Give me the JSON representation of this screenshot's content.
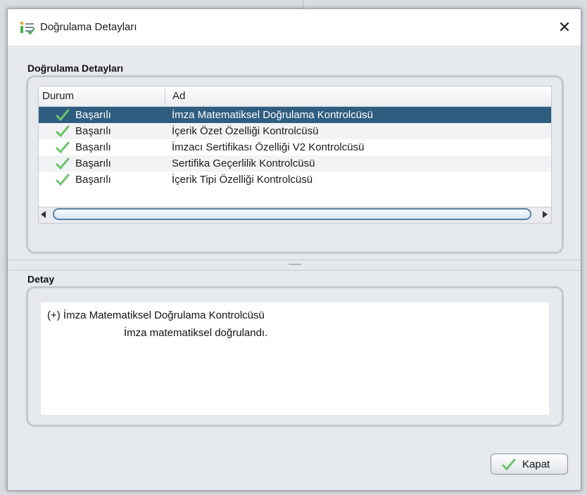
{
  "window": {
    "title": "Doğrulama Detayları",
    "icon": "app-verify-icon",
    "close_glyph": "✕"
  },
  "results_section": {
    "title": "Doğrulama Detayları",
    "columns": [
      "Durum",
      "Ad"
    ],
    "rows": [
      {
        "status": "Başarılı",
        "name": "İmza Matematiksel Doğrulama Kontrolcüsü",
        "selected": true
      },
      {
        "status": "Başarılı",
        "name": "İçerik Özet Özelliği Kontrolcüsü",
        "selected": false
      },
      {
        "status": "Başarılı",
        "name": "İmzacı Sertifikası Özelliği V2 Kontrolcüsü",
        "selected": false
      },
      {
        "status": "Başarılı",
        "name": "Sertifika Geçerlilik Kontrolcüsü",
        "selected": false
      },
      {
        "status": "Başarılı",
        "name": "İçerik Tipi Özelliği Kontrolcüsü",
        "selected": false
      }
    ]
  },
  "detail_section": {
    "title": "Detay",
    "line1": "(+) İmza Matematiksel Doğrulama Kontrolcüsü",
    "line2": "İmza matematiksel doğrulandı."
  },
  "buttons": {
    "close_label": "Kapat"
  },
  "colors": {
    "selection": "#2e5d80",
    "check_green": "#5cb85c",
    "dialog_bg": "#e6e9ed"
  }
}
